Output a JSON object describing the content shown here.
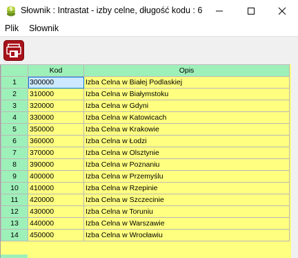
{
  "window": {
    "title": "Słownik : Intrastat - izby celne,  długość kodu : 6",
    "controls": {
      "minimize": "minimize",
      "maximize": "maximize",
      "close": "close"
    }
  },
  "menu": {
    "items": [
      "Plik",
      "Słownik"
    ]
  },
  "toolbar": {
    "print_icon": "print-icon"
  },
  "grid": {
    "columns": [
      "Kod",
      "Opis"
    ],
    "selected_row": 1,
    "rows": [
      {
        "n": "1",
        "kod": "300000",
        "opis": "Izba Celna w Białej Podlaskiej"
      },
      {
        "n": "2",
        "kod": "310000",
        "opis": "Izba Celna w Białymstoku"
      },
      {
        "n": "3",
        "kod": "320000",
        "opis": "Izba Celna w Gdyni"
      },
      {
        "n": "4",
        "kod": "330000",
        "opis": "Izba Celna w Katowicach"
      },
      {
        "n": "5",
        "kod": "350000",
        "opis": "Izba Celna w Krakowie"
      },
      {
        "n": "6",
        "kod": "360000",
        "opis": "Izba Celna w Łodzi"
      },
      {
        "n": "7",
        "kod": "370000",
        "opis": "Izba Celna w Olsztynie"
      },
      {
        "n": "8",
        "kod": "390000",
        "opis": "Izba Celna w Poznaniu"
      },
      {
        "n": "9",
        "kod": "400000",
        "opis": "Izba Celna w Przemyślu"
      },
      {
        "n": "10",
        "kod": "410000",
        "opis": "Izba Celna w Rzepinie"
      },
      {
        "n": "11",
        "kod": "420000",
        "opis": "Izba Celna w Szczecinie"
      },
      {
        "n": "12",
        "kod": "430000",
        "opis": "Izba Celna w Toruniu"
      },
      {
        "n": "13",
        "kod": "440000",
        "opis": "Izba Celna w Warszawie"
      },
      {
        "n": "14",
        "kod": "450000",
        "opis": "Izba Celna w Wrocławiu"
      }
    ]
  },
  "colors": {
    "header_bg": "#9ef0b9",
    "cell_bg": "#ffff80",
    "selected_bg": "#cce8ff",
    "print_button": "#a8121a"
  }
}
